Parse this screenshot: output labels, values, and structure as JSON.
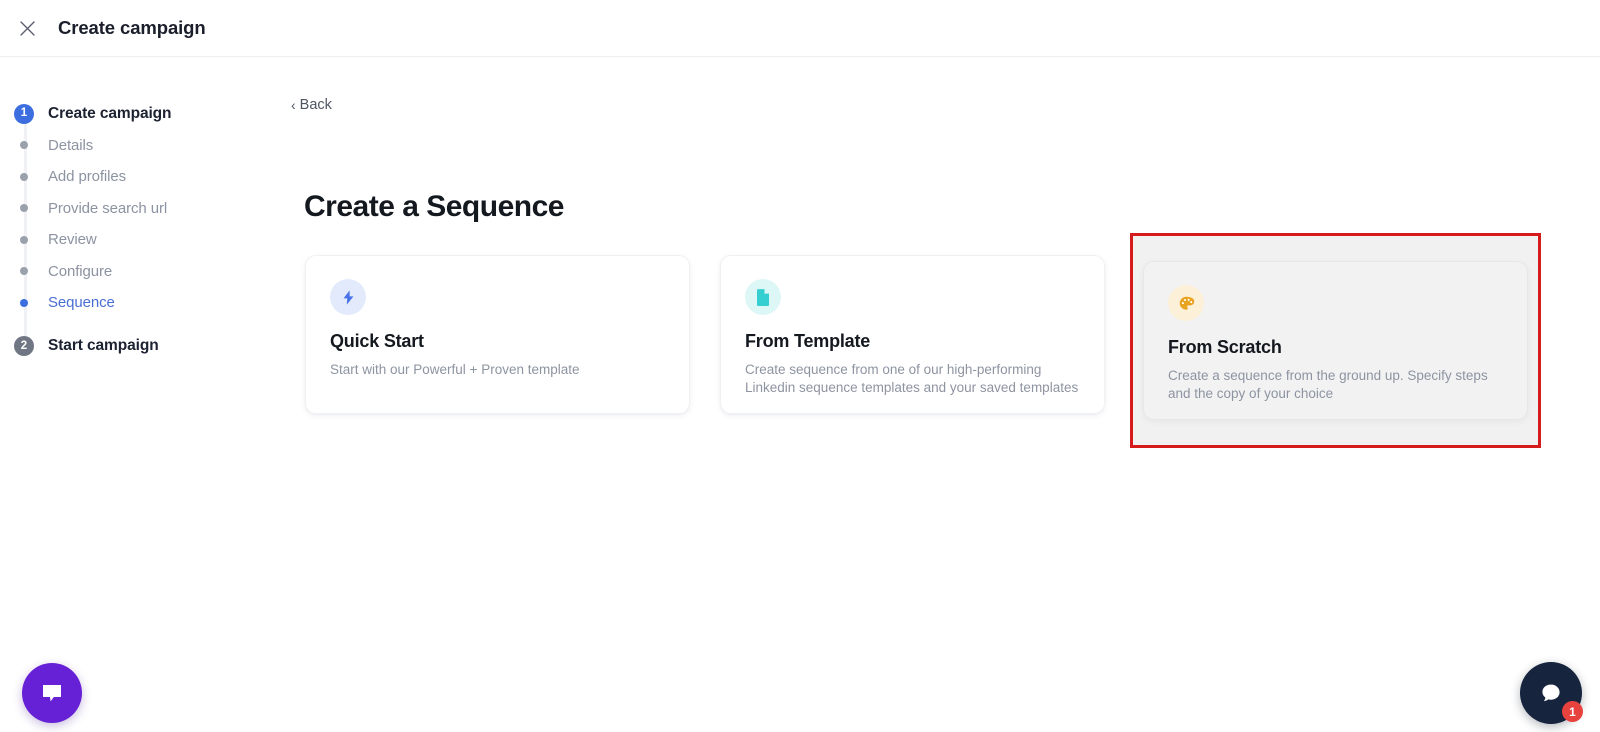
{
  "header": {
    "title": "Create campaign",
    "close_icon": "close-icon"
  },
  "sidebar": {
    "steps": [
      {
        "marker": "1",
        "type": "badge-primary",
        "label": "Create campaign",
        "state": "head"
      },
      {
        "marker": "dot",
        "type": "dot",
        "label": "Details",
        "state": "inactive"
      },
      {
        "marker": "dot",
        "type": "dot",
        "label": "Add profiles",
        "state": "inactive"
      },
      {
        "marker": "dot",
        "type": "dot",
        "label": "Provide search url",
        "state": "inactive"
      },
      {
        "marker": "dot",
        "type": "dot",
        "label": "Review",
        "state": "inactive"
      },
      {
        "marker": "dot",
        "type": "dot",
        "label": "Configure",
        "state": "inactive"
      },
      {
        "marker": "dot",
        "type": "dot-active",
        "label": "Sequence",
        "state": "active"
      },
      {
        "marker": "2",
        "type": "badge-muted",
        "label": "Start campaign",
        "state": "head"
      }
    ]
  },
  "main": {
    "back_label": "Back",
    "back_chevron": "chevron-left-icon",
    "page_title": "Create a Sequence",
    "cards": [
      {
        "icon": "lightning-bolt-icon",
        "title": "Quick Start",
        "description": "Start with our Powerful + Proven template"
      },
      {
        "icon": "document-icon",
        "title": "From Template",
        "description": "Create sequence from one of our high-performing Linkedin sequence templates and your saved templates"
      },
      {
        "icon": "paint-palette-icon",
        "title": "From Scratch",
        "description": "Create a sequence from the ground up. Specify steps and the copy of your choice"
      }
    ]
  },
  "widgets": {
    "chat_icon": "chat-bubble-icon",
    "support_icon": "support-bubble-icon",
    "support_badge_count": "1"
  },
  "colors": {
    "accent_blue": "#3d6ee0",
    "icon_blue": "#4a72e8",
    "icon_teal": "#35cfd2",
    "icon_amber": "#e8a321",
    "highlight_red": "#d51b1b",
    "chat_purple": "#6621d6",
    "support_navy": "#16253d",
    "badge_red": "#e8423f"
  }
}
